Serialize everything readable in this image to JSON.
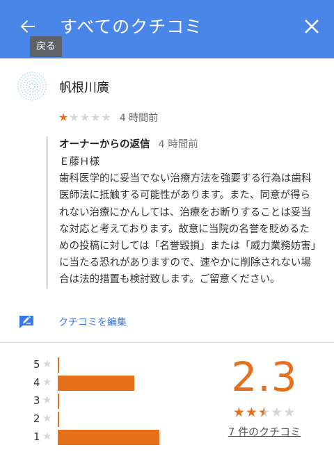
{
  "appbar": {
    "title": "すべてのクチコミ",
    "back_tooltip": "戻る",
    "background": "#4a86e8"
  },
  "review": {
    "reviewer": "帆根川廣",
    "rating": 1,
    "max_rating": 5,
    "time": "4 時間前",
    "owner_reply": {
      "label": "オーナーからの返信",
      "time": "4 時間前",
      "salutation": "Ｅ藤Ｈ様",
      "body": "歯科医学的に妥当でない治療方法を強要する行為は歯科医師法に抵触する可能性があります。また、同意が得られない治療にかんしては、治療をお断りすることは妥当な対応と考えております。故意に当院の名誉を貶めるための投稿に対しては「名誉毀損」または「威力業務妨害」に当たる恐れがありますので、速やかに削除されない場合は法的措置も検討致します。ご留意ください。"
    }
  },
  "edit": {
    "label": "クチコミを編集",
    "icon": "pencil-edit-icon"
  },
  "summary": {
    "average": "2.3",
    "average_value": 2.5,
    "review_count_label": "7 件のクチコミ",
    "accent": "#e7711b"
  },
  "histogram": [
    {
      "stars": "5",
      "fraction": 0
    },
    {
      "stars": "4",
      "fraction": 0.55
    },
    {
      "stars": "3",
      "fraction": 0
    },
    {
      "stars": "2",
      "fraction": 0
    },
    {
      "stars": "1",
      "fraction": 0.73
    }
  ]
}
